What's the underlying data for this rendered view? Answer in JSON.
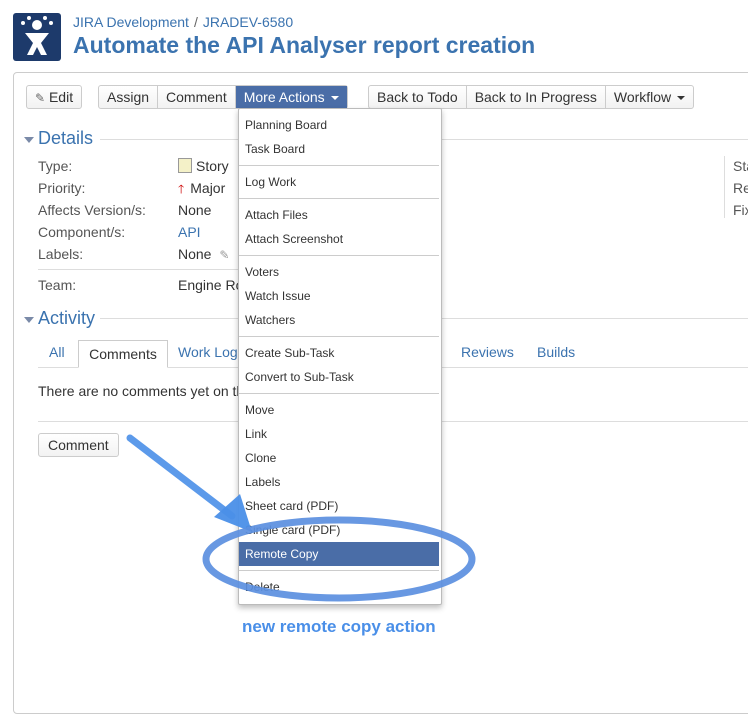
{
  "header": {
    "project": "JIRA Development",
    "separator": "/",
    "issue_key": "JRADEV-6580",
    "title": "Automate the API Analyser report creation"
  },
  "toolbar": {
    "edit": "Edit",
    "assign": "Assign",
    "comment": "Comment",
    "more_actions": "More Actions",
    "back_to_todo": "Back to Todo",
    "back_to_in_progress": "Back to In Progress",
    "workflow": "Workflow"
  },
  "details": {
    "title": "Details",
    "type_label": "Type:",
    "type_value": "Story",
    "priority_label": "Priority:",
    "priority_value": "Major",
    "affects_label": "Affects Version/s:",
    "affects_value": "None",
    "component_label": "Component/s:",
    "component_value": "API",
    "labels_label": "Labels:",
    "labels_value": "None",
    "team_label": "Team:",
    "team_value": "Engine Ro",
    "right_col": [
      "Sta",
      "Re",
      "Fix"
    ]
  },
  "activity": {
    "title": "Activity",
    "tabs": [
      "All",
      "Comments",
      "Work Log",
      "Reviews",
      "Builds"
    ],
    "empty_text": "There are no comments yet on th",
    "comment_button": "Comment"
  },
  "menu": {
    "items": [
      "Planning Board",
      "Task Board",
      "Log Work",
      "Attach Files",
      "Attach Screenshot",
      "Voters",
      "Watch Issue",
      "Watchers",
      "Create Sub-Task",
      "Convert to Sub-Task",
      "Move",
      "Link",
      "Clone",
      "Labels",
      "Sheet card (PDF)",
      "Single card (PDF)",
      "Remote Copy",
      "Delete"
    ],
    "highlighted": "Remote Copy"
  },
  "annotation": {
    "text": "new remote copy action",
    "color": "#4a8fe8"
  },
  "colors": {
    "accent": "#3b73af",
    "active": "#4a6da7",
    "annotation": "#5b8fe0"
  }
}
